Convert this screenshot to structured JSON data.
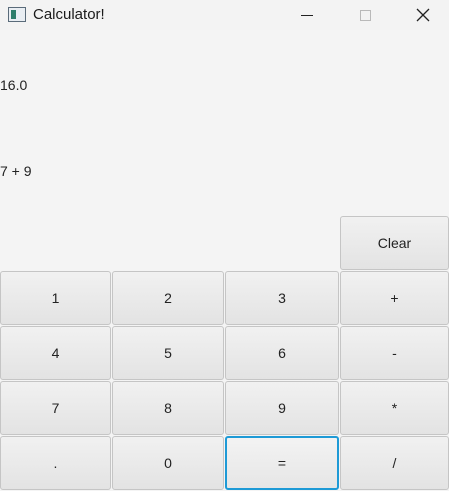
{
  "window": {
    "title": "Calculator!",
    "icon": "java-app-icon",
    "controls": [
      "minimize-icon",
      "maximize-icon",
      "close-icon"
    ]
  },
  "display": {
    "result": "16.0",
    "expression": "7 + 9"
  },
  "keys": {
    "clear": "Clear",
    "k1": "1",
    "k2": "2",
    "k3": "3",
    "plus": "+",
    "k4": "4",
    "k5": "5",
    "k6": "6",
    "minus": "-",
    "k7": "7",
    "k8": "8",
    "k9": "9",
    "multiply": "*",
    "dot": ".",
    "k0": "0",
    "equals": "=",
    "divide": "/"
  },
  "colors": {
    "focus_ring": "#1e9ad6",
    "background": "#f4f4f4"
  }
}
